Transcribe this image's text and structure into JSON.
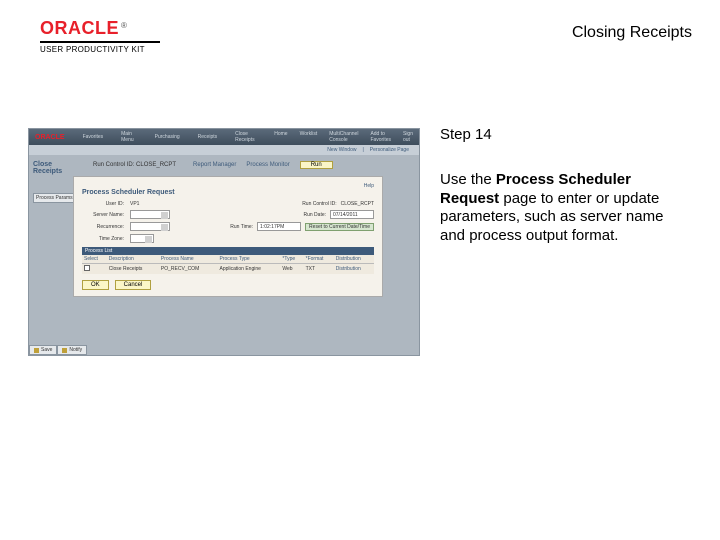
{
  "header": {
    "brand": "ORACLE",
    "trademark": "®",
    "subline": "USER PRODUCTIVITY KIT",
    "title": "Closing Receipts"
  },
  "instructions": {
    "step_label": "Step 14",
    "text_prefix": "Use the ",
    "text_bold": "Process Scheduler Request",
    "text_suffix": " page to enter or update parameters, such as server name and process output format."
  },
  "screenshot": {
    "top_brand": "ORACLE",
    "top_left_items": [
      "Favorites",
      "Main Menu",
      "Purchasing",
      "Receipts",
      "Close Receipts"
    ],
    "top_right_items": [
      "Home",
      "Worklist",
      "MultiChannel Console",
      "Add to Favorites",
      "Sign out"
    ],
    "subnav": {
      "new_window": "New Window",
      "personalize": "Personalize Page"
    },
    "page_title": "Close Receipts",
    "process_params_btn": "Process Params",
    "run_ctrl_label": "Run Control ID:",
    "run_ctrl_value": "CLOSE_RCPT",
    "report_mgr": "Report Manager",
    "process_mon": "Process Monitor",
    "run_btn": "Run",
    "modal": {
      "title": "Process Scheduler Request",
      "user_label": "User ID:",
      "user_value": "VP1",
      "runctl_label": "Run Control ID:",
      "runctl_value": "CLOSE_RCPT",
      "server_label": "Server Name:",
      "rundate_label": "Run Date:",
      "rundate_value": "07/14/2011",
      "recurrence_label": "Recurrence:",
      "runtime_label": "Run Time:",
      "runtime_value": "1:02:17PM",
      "reset_btn": "Reset to Current Date/Time",
      "timezone_label": "Time Zone:",
      "help": "Help",
      "plist_header": "Process List",
      "cols": {
        "select": "Select",
        "desc": "Description",
        "pname": "Process Name",
        "ptype": "Process Type",
        "type": "*Type",
        "format": "*Format",
        "dist": "Distribution"
      },
      "row": {
        "desc": "Close Receipts",
        "pname": "PO_RECV_COM",
        "ptype": "Application Engine",
        "type": "Web",
        "format": "TXT",
        "dist": "Distribution"
      },
      "ok": "OK",
      "cancel": "Cancel"
    },
    "bottom_tabs": {
      "save": "Save",
      "notify": "Notify"
    }
  }
}
